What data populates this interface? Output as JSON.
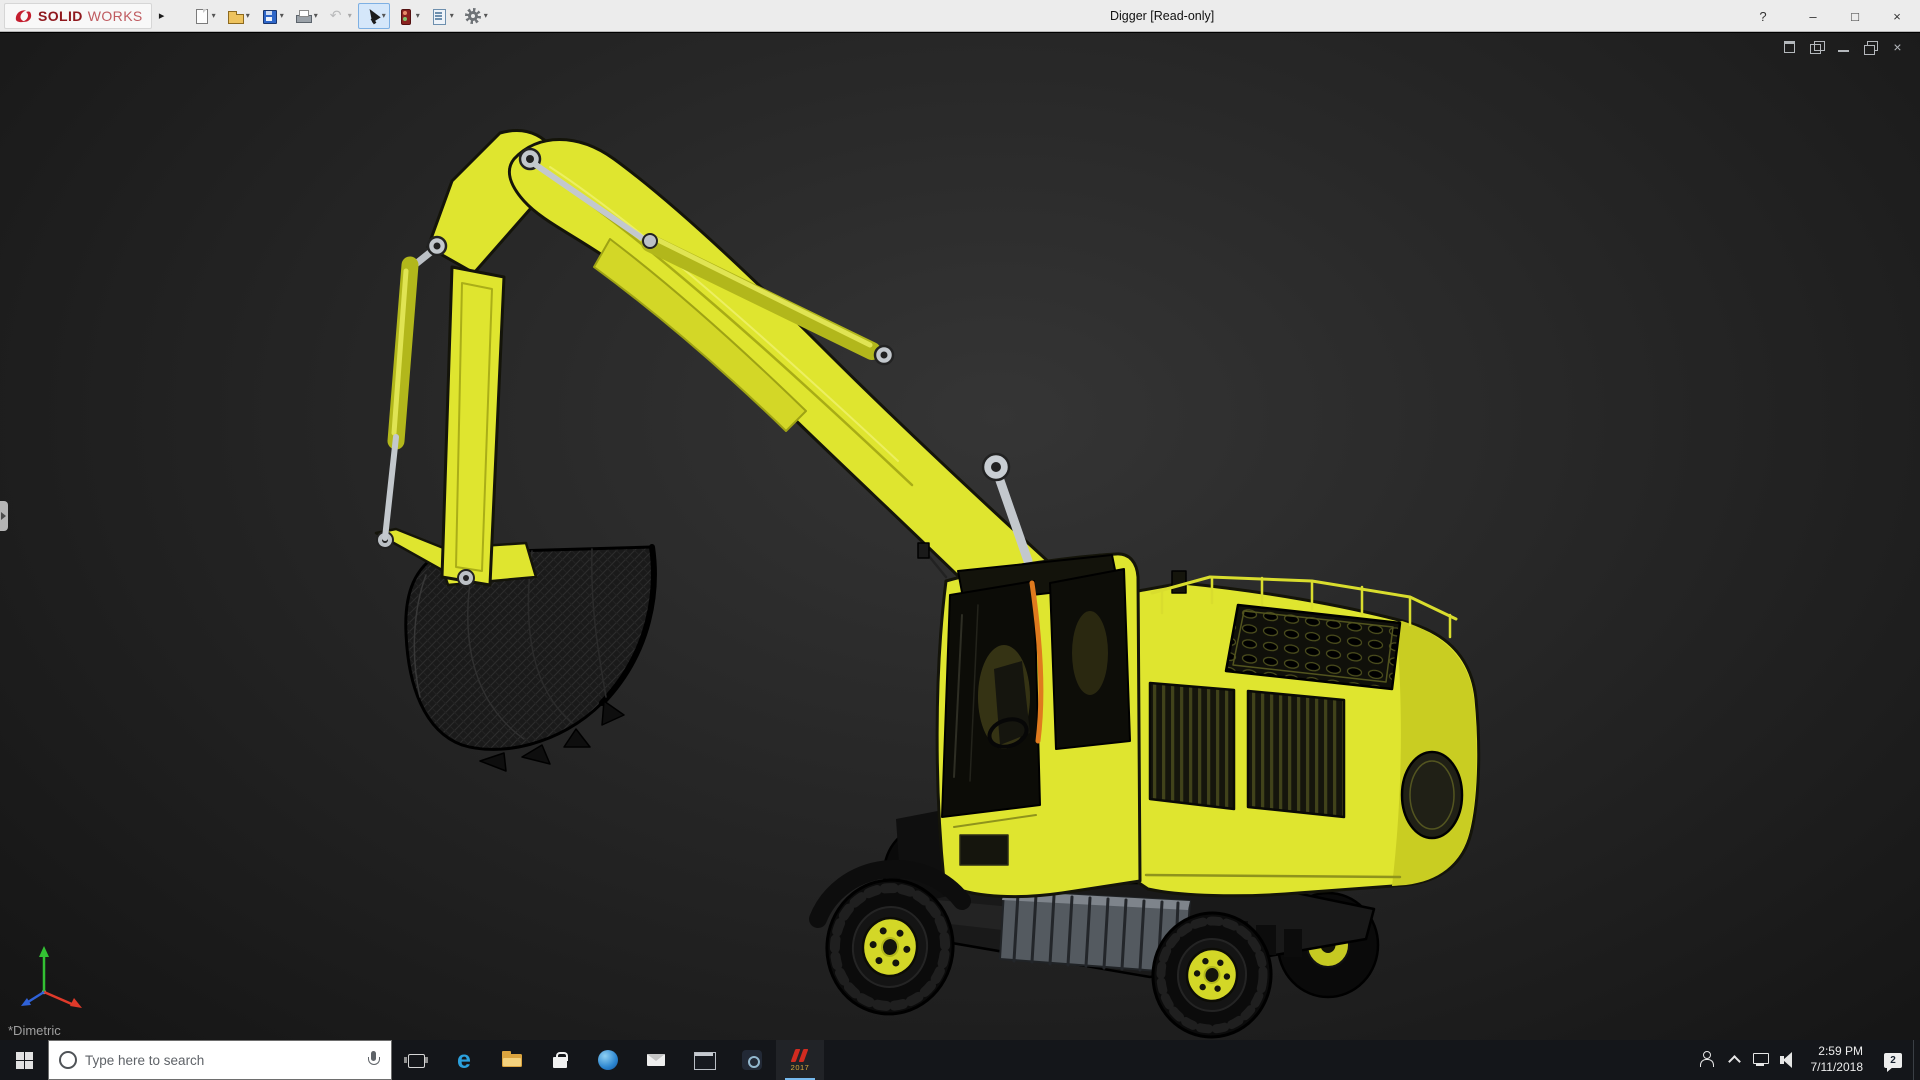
{
  "window": {
    "title": "Digger [Read-only]",
    "brand": {
      "bold": "SOLID",
      "light": "WORKS",
      "logo_icon": "dassault-systemes-logo-icon"
    },
    "menu_expand_glyph": "▸",
    "dropdown_glyph": "▾",
    "toolbar": [
      {
        "name": "new-document-button",
        "icon": "new",
        "dropdown": true
      },
      {
        "name": "open-button",
        "icon": "open",
        "dropdown": true
      },
      {
        "name": "save-button",
        "icon": "save",
        "dropdown": true
      },
      {
        "name": "print-button",
        "icon": "print",
        "dropdown": true
      },
      {
        "name": "undo-button",
        "icon": "undo",
        "dropdown": true,
        "disabled": true
      },
      {
        "name": "select-button",
        "icon": "select",
        "dropdown": true,
        "active": true
      },
      {
        "name": "rebuild-button",
        "icon": "rebuild"
      },
      {
        "name": "file-properties-button",
        "icon": "props"
      },
      {
        "name": "options-button",
        "icon": "gear",
        "dropdown": true
      }
    ],
    "controls": [
      {
        "name": "help-button",
        "glyph": "?"
      },
      {
        "name": "minimize-button",
        "glyph": "–"
      },
      {
        "name": "maximize-button",
        "glyph": "□"
      },
      {
        "name": "close-button",
        "glyph": "×"
      }
    ]
  },
  "viewport": {
    "doc_window_controls": [
      {
        "name": "doc-window-icon",
        "icon": "win"
      },
      {
        "name": "doc-cascade-icon",
        "icon": "cascade"
      },
      {
        "name": "doc-minimize-icon",
        "icon": "min"
      },
      {
        "name": "doc-restore-icon",
        "icon": "restore"
      },
      {
        "name": "doc-close-icon",
        "icon": "close",
        "glyph": "×"
      }
    ],
    "expand_tab_icon": "feature-panel-expand-icon",
    "triad_icon": "orientation-triad-icon",
    "orientation_label": "*Dimetric",
    "model": {
      "name": "Digger",
      "type": "excavator 3D model",
      "body_color": "#dfe52f",
      "outline_color": "#14140a"
    }
  },
  "taskbar": {
    "start": {
      "name": "start-button",
      "icon": "windows-logo-icon"
    },
    "search": {
      "placeholder": "Type here to search",
      "ring_icon": "cortana-ring-icon",
      "mic_icon": "microphone-icon"
    },
    "apps": [
      {
        "name": "task-view-button",
        "icon": "taskview"
      },
      {
        "name": "edge-browser-icon",
        "icon": "edge",
        "glyph": "e"
      },
      {
        "name": "file-explorer-icon",
        "icon": "explorer"
      },
      {
        "name": "store-icon",
        "icon": "store"
      },
      {
        "name": "browser-ball-icon",
        "icon": "ball"
      },
      {
        "name": "mail-icon",
        "icon": "mail"
      },
      {
        "name": "command-prompt-icon",
        "icon": "console"
      },
      {
        "name": "round-app-icon",
        "icon": "roundapp"
      },
      {
        "name": "solidworks-2017-icon",
        "icon": "sw",
        "label": "2017",
        "running": true
      }
    ],
    "tray": {
      "icons": [
        {
          "name": "people-icon",
          "icon": "people"
        },
        {
          "name": "hidden-icons-chevron",
          "icon": "chevron"
        },
        {
          "name": "network-icon",
          "icon": "network"
        },
        {
          "name": "volume-icon",
          "icon": "volume"
        }
      ],
      "time": "2:59 PM",
      "date": "7/11/2018",
      "action_center_icon": "action-center-icon",
      "notification_badge": "2",
      "show_desktop_name": "show-desktop-button"
    }
  }
}
